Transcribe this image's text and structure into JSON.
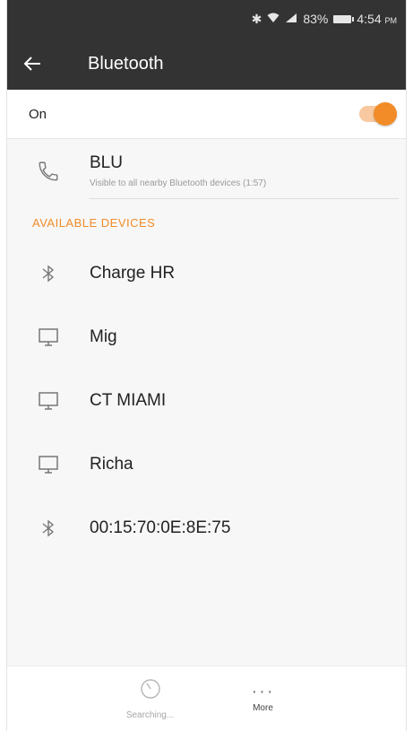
{
  "status_bar": {
    "battery_percent": "83%",
    "time": "4:54",
    "time_suffix": "PM"
  },
  "toolbar": {
    "title": "Bluetooth"
  },
  "bluetooth_toggle": {
    "label": "On",
    "enabled": true
  },
  "this_device": {
    "name": "BLU",
    "visibility_text": "Visible to all nearby Bluetooth devices (1:57)"
  },
  "available_devices": {
    "header": "AVAILABLE DEVICES",
    "items": [
      {
        "label": "Charge HR",
        "icon": "bluetooth-icon"
      },
      {
        "label": "Mig",
        "icon": "computer-icon"
      },
      {
        "label": "CT MIAMI",
        "icon": "computer-icon"
      },
      {
        "label": "Richa",
        "icon": "computer-icon"
      },
      {
        "label": "00:15:70:0E:8E:75",
        "icon": "bluetooth-icon"
      }
    ]
  },
  "bottom_bar": {
    "search_label": "Searching...",
    "more_label": "More"
  },
  "colors": {
    "accent": "#f28c28",
    "toolbar_bg": "#333333"
  }
}
